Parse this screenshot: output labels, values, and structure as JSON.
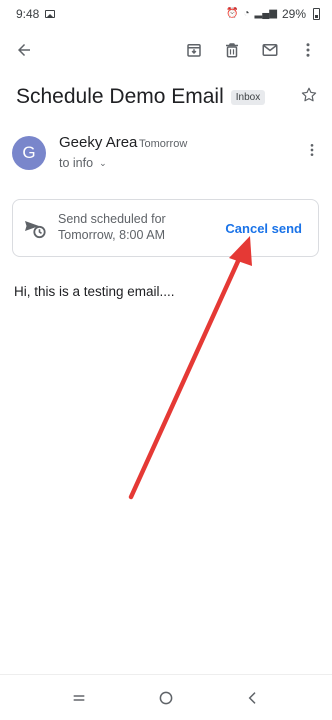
{
  "status_bar": {
    "time": "9:48",
    "battery": "29%"
  },
  "email": {
    "subject": "Schedule Demo Email",
    "label": "Inbox",
    "avatar_initial": "G",
    "sender_name": "Geeky Area",
    "time": "Tomorrow",
    "recipient": "to info",
    "body": "Hi, this is a testing email...."
  },
  "schedule": {
    "line1": "Send scheduled for",
    "line2": "Tomorrow, 8:00 AM",
    "cancel_label": "Cancel send"
  },
  "colors": {
    "accent": "#1a73e8",
    "avatar": "#7986cb",
    "annotation_arrow": "#e53935"
  },
  "icons": [
    "back-arrow-icon",
    "archive-icon",
    "delete-icon",
    "mail-icon",
    "more-vert-icon",
    "star-icon",
    "scheduled-send-icon",
    "recent-apps-icon",
    "home-icon",
    "back-nav-icon"
  ]
}
